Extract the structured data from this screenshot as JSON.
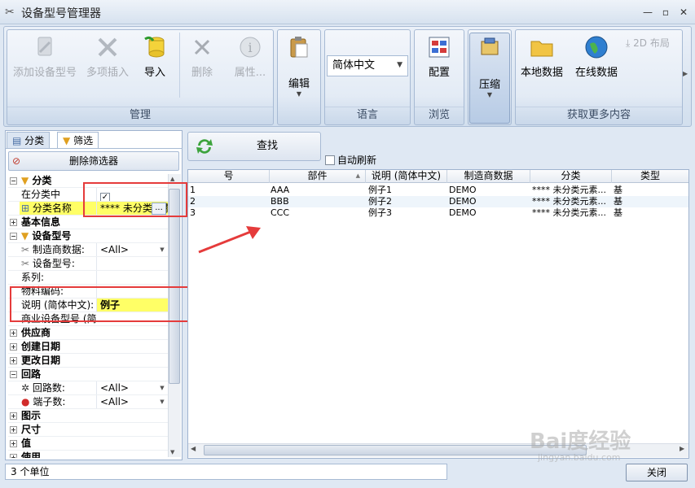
{
  "window": {
    "title": "设备型号管理器",
    "min": "—",
    "restore": "▫",
    "close": "✕"
  },
  "ribbon": {
    "groups": {
      "manage": "管理",
      "edit": "编辑",
      "language": "语言",
      "browse": "浏览",
      "compress": "压缩",
      "more": "获取更多内容"
    },
    "buttons": {
      "add_model": "添加设备型号",
      "multi_insert": "多项插入",
      "import": "导入",
      "delete": "删除",
      "properties": "属性...",
      "edit": "编辑",
      "config": "配置",
      "compress": "压缩",
      "local_data": "本地数据",
      "online_data": "在线数据",
      "layout_2d": "2D 布局"
    },
    "language_value": "简体中文",
    "colors": {
      "ribbon_bg": "#dfe8f3",
      "accent": "#3a4b63"
    }
  },
  "left": {
    "tabs": {
      "category": "分类",
      "filter": "筛选"
    },
    "delete_filter": "删除筛选器",
    "sections": {
      "category": "分类",
      "basic_info": "基本信息",
      "model": "设备型号",
      "supplier": "供应商",
      "created": "创建日期",
      "modified": "更改日期",
      "circuit": "回路",
      "diagram": "图示",
      "size": "尺寸",
      "value": "值",
      "usage": "使用"
    },
    "props": {
      "in_category": "在分类中",
      "in_category_checked": "✓",
      "category_name": "分类名称",
      "category_name_value": "**** 未分类元素",
      "manufacturer": "制造商数据:",
      "manufacturer_value": "<All>",
      "model_no": "设备型号:",
      "series": "系列:",
      "material": "物料编码:",
      "desc": "说明 (简体中文):",
      "desc_value": "例子",
      "commercial": "商业设备型号 (简",
      "circuit_count": "回路数:",
      "circuit_count_value": "<All>",
      "terminal_count": "端子数:",
      "terminal_count_value": "<All>"
    }
  },
  "right": {
    "search": "查找",
    "auto_refresh": "自动刷新",
    "columns": [
      "号",
      "部件",
      "说明 (简体中文)",
      "制造商数据",
      "分类",
      "类型"
    ],
    "rows": [
      {
        "no": "1",
        "part": "AAA",
        "desc": "例子1",
        "mfr": "DEMO",
        "cat": "**** 未分类元素...",
        "type": "基"
      },
      {
        "no": "2",
        "part": "BBB",
        "desc": "例子2",
        "mfr": "DEMO",
        "cat": "**** 未分类元素...",
        "type": "基"
      },
      {
        "no": "3",
        "part": "CCC",
        "desc": "例子3",
        "mfr": "DEMO",
        "cat": "**** 未分类元素...",
        "type": "基"
      }
    ]
  },
  "status": {
    "units": "3 个单位",
    "close": "关闭"
  },
  "watermark": {
    "main": "Bai度经验",
    "sub": "jingyan.baidu.com"
  }
}
